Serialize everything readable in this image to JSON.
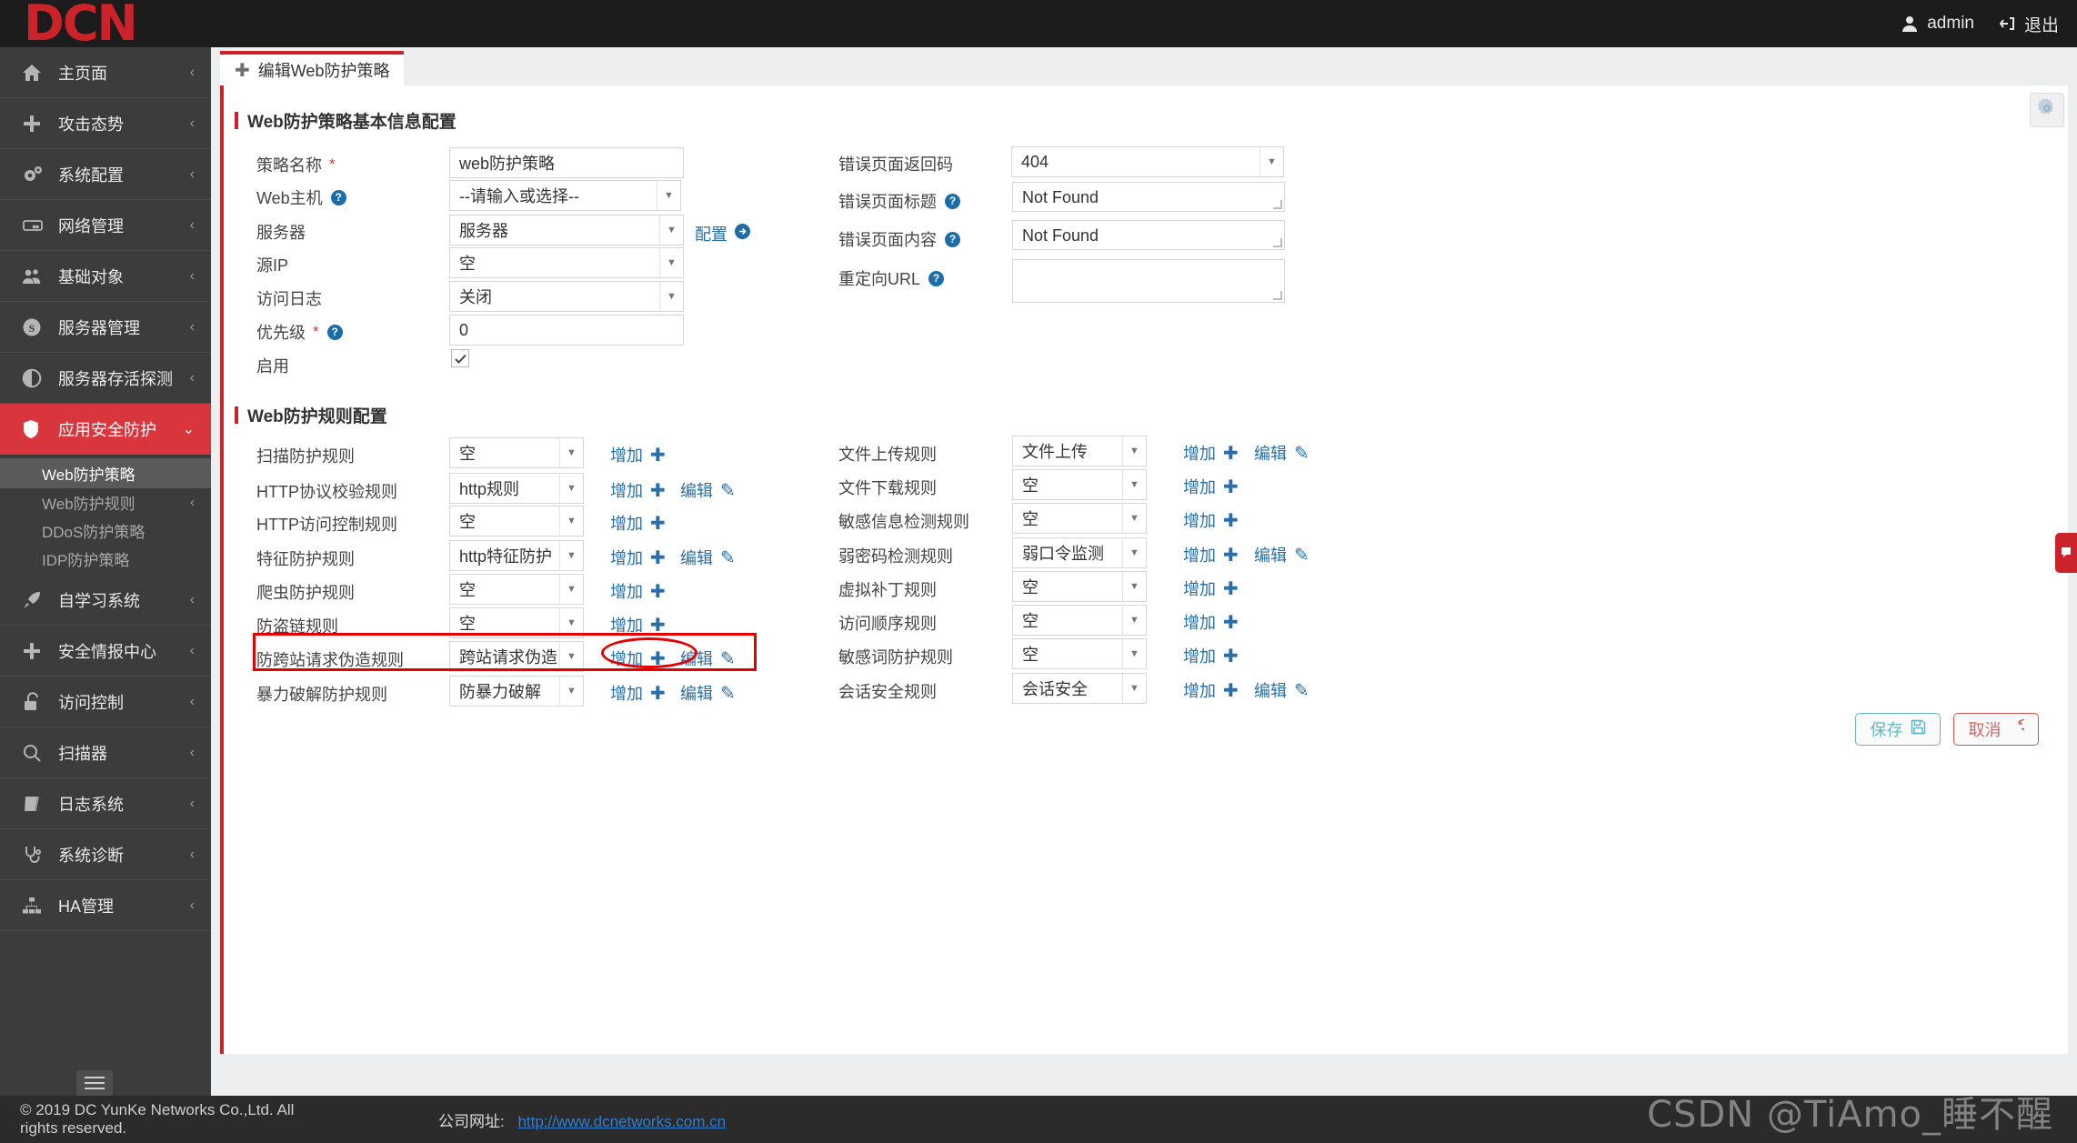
{
  "topbar": {
    "logo": "DCN",
    "user": "admin",
    "logout": "退出",
    "user_icon": "user-icon",
    "logout_icon": "logout-icon"
  },
  "sidebar": {
    "items": [
      {
        "label": "主页面",
        "icon": "home-icon",
        "chevron": "‹"
      },
      {
        "label": "攻击态势",
        "icon": "plus-icon",
        "chevron": "‹"
      },
      {
        "label": "系统配置",
        "icon": "gears-icon",
        "chevron": "‹"
      },
      {
        "label": "网络管理",
        "icon": "server-icon",
        "chevron": "‹"
      },
      {
        "label": "基础对象",
        "icon": "users-icon",
        "chevron": "‹"
      },
      {
        "label": "服务器管理",
        "icon": "skype-icon",
        "chevron": "‹"
      },
      {
        "label": "服务器存活探测",
        "icon": "contrast-icon",
        "chevron": "‹"
      },
      {
        "label": "应用安全防护",
        "icon": "shield-icon",
        "chevron": "⌄",
        "active": true
      },
      {
        "label": "自学习系统",
        "icon": "rocket-icon",
        "chevron": "‹"
      },
      {
        "label": "安全情报中心",
        "icon": "plus-icon",
        "chevron": "‹"
      },
      {
        "label": "访问控制",
        "icon": "unlock-icon",
        "chevron": "‹"
      },
      {
        "label": "扫描器",
        "icon": "search-icon",
        "chevron": "‹"
      },
      {
        "label": "日志系统",
        "icon": "book-icon",
        "chevron": "‹"
      },
      {
        "label": "系统诊断",
        "icon": "stethoscope-icon",
        "chevron": "‹"
      },
      {
        "label": "HA管理",
        "icon": "sitemap-icon",
        "chevron": "‹"
      }
    ],
    "subitems": [
      {
        "label": "Web防护策略",
        "active": true
      },
      {
        "label": "Web防护规则",
        "chevron": "‹"
      },
      {
        "label": "DDoS防护策略"
      },
      {
        "label": "IDP防护策略"
      }
    ]
  },
  "tab": {
    "label": "编辑Web防护策略",
    "plus": "✚"
  },
  "section1": {
    "title": "Web防护策略基本信息配置",
    "left_fields": [
      {
        "label": "策略名称",
        "required": "*",
        "type": "text",
        "value": "web防护策略"
      },
      {
        "label": "Web主机",
        "help": "?",
        "type": "select",
        "placeholder": "--请输入或选择--",
        "value": ""
      },
      {
        "label": "服务器",
        "type": "select",
        "value": "服务器",
        "link": "配置"
      },
      {
        "label": "源IP",
        "type": "select",
        "value": "空"
      },
      {
        "label": "访问日志",
        "type": "select",
        "value": "关闭"
      },
      {
        "label": "优先级",
        "required": "*",
        "help": "?",
        "type": "text",
        "value": "0"
      },
      {
        "label": "启用",
        "type": "checkbox",
        "checked": true
      }
    ],
    "right_fields": [
      {
        "label": "错误页面返回码",
        "type": "select",
        "value": "404"
      },
      {
        "label": "错误页面标题",
        "help": "?",
        "type": "textarea",
        "value": "Not Found"
      },
      {
        "label": "错误页面内容",
        "help": "?",
        "type": "textarea",
        "value": "Not Found"
      },
      {
        "label": "重定向URL",
        "help": "?",
        "type": "textarea",
        "value": ""
      }
    ]
  },
  "section2": {
    "title": "Web防护规则配置",
    "add_label": "增加",
    "edit_label": "编辑",
    "add_glyph": "✚",
    "edit_glyph": "✎",
    "left_rules": [
      {
        "label": "扫描防护规则",
        "value": "空",
        "add": true,
        "edit": false
      },
      {
        "label": "HTTP协议校验规则",
        "value": "http规则",
        "add": true,
        "edit": true
      },
      {
        "label": "HTTP访问控制规则",
        "value": "空",
        "add": true,
        "edit": false
      },
      {
        "label": "特征防护规则",
        "value": "http特征防护",
        "add": true,
        "edit": true
      },
      {
        "label": "爬虫防护规则",
        "value": "空",
        "add": true,
        "edit": false
      },
      {
        "label": "防盗链规则",
        "value": "空",
        "add": true,
        "edit": false
      },
      {
        "label": "防跨站请求伪造规则",
        "value": "跨站请求伪造",
        "add": true,
        "edit": true,
        "highlighted": true
      },
      {
        "label": "暴力破解防护规则",
        "value": "防暴力破解",
        "add": true,
        "edit": true
      }
    ],
    "right_rules": [
      {
        "label": "文件上传规则",
        "value": "文件上传",
        "add": true,
        "edit": true
      },
      {
        "label": "文件下载规则",
        "value": "空",
        "add": true,
        "edit": false
      },
      {
        "label": "敏感信息检测规则",
        "value": "空",
        "add": true,
        "edit": false
      },
      {
        "label": "弱密码检测规则",
        "value": "弱口令监测",
        "add": true,
        "edit": true
      },
      {
        "label": "虚拟补丁规则",
        "value": "空",
        "add": true,
        "edit": false
      },
      {
        "label": "访问顺序规则",
        "value": "空",
        "add": true,
        "edit": false
      },
      {
        "label": "敏感词防护规则",
        "value": "空",
        "add": true,
        "edit": false
      },
      {
        "label": "会话安全规则",
        "value": "会话安全",
        "add": true,
        "edit": true
      }
    ]
  },
  "buttons": {
    "save": "保存",
    "save_icon": "floppy-icon",
    "cancel": "取消",
    "cancel_icon": "undo-icon"
  },
  "footer": {
    "copyright": "© 2019 DC YunKe Networks Co.,Ltd. All rights reserved.",
    "site_label": "公司网址:",
    "site_url": "http://www.dcnetworks.com.cn"
  },
  "watermark": "CSDN @TiAmo_睡不醒",
  "colors": {
    "brand_red": "#cc2229",
    "accent_blue": "#2a6ea8",
    "highlight": "#e60000"
  }
}
